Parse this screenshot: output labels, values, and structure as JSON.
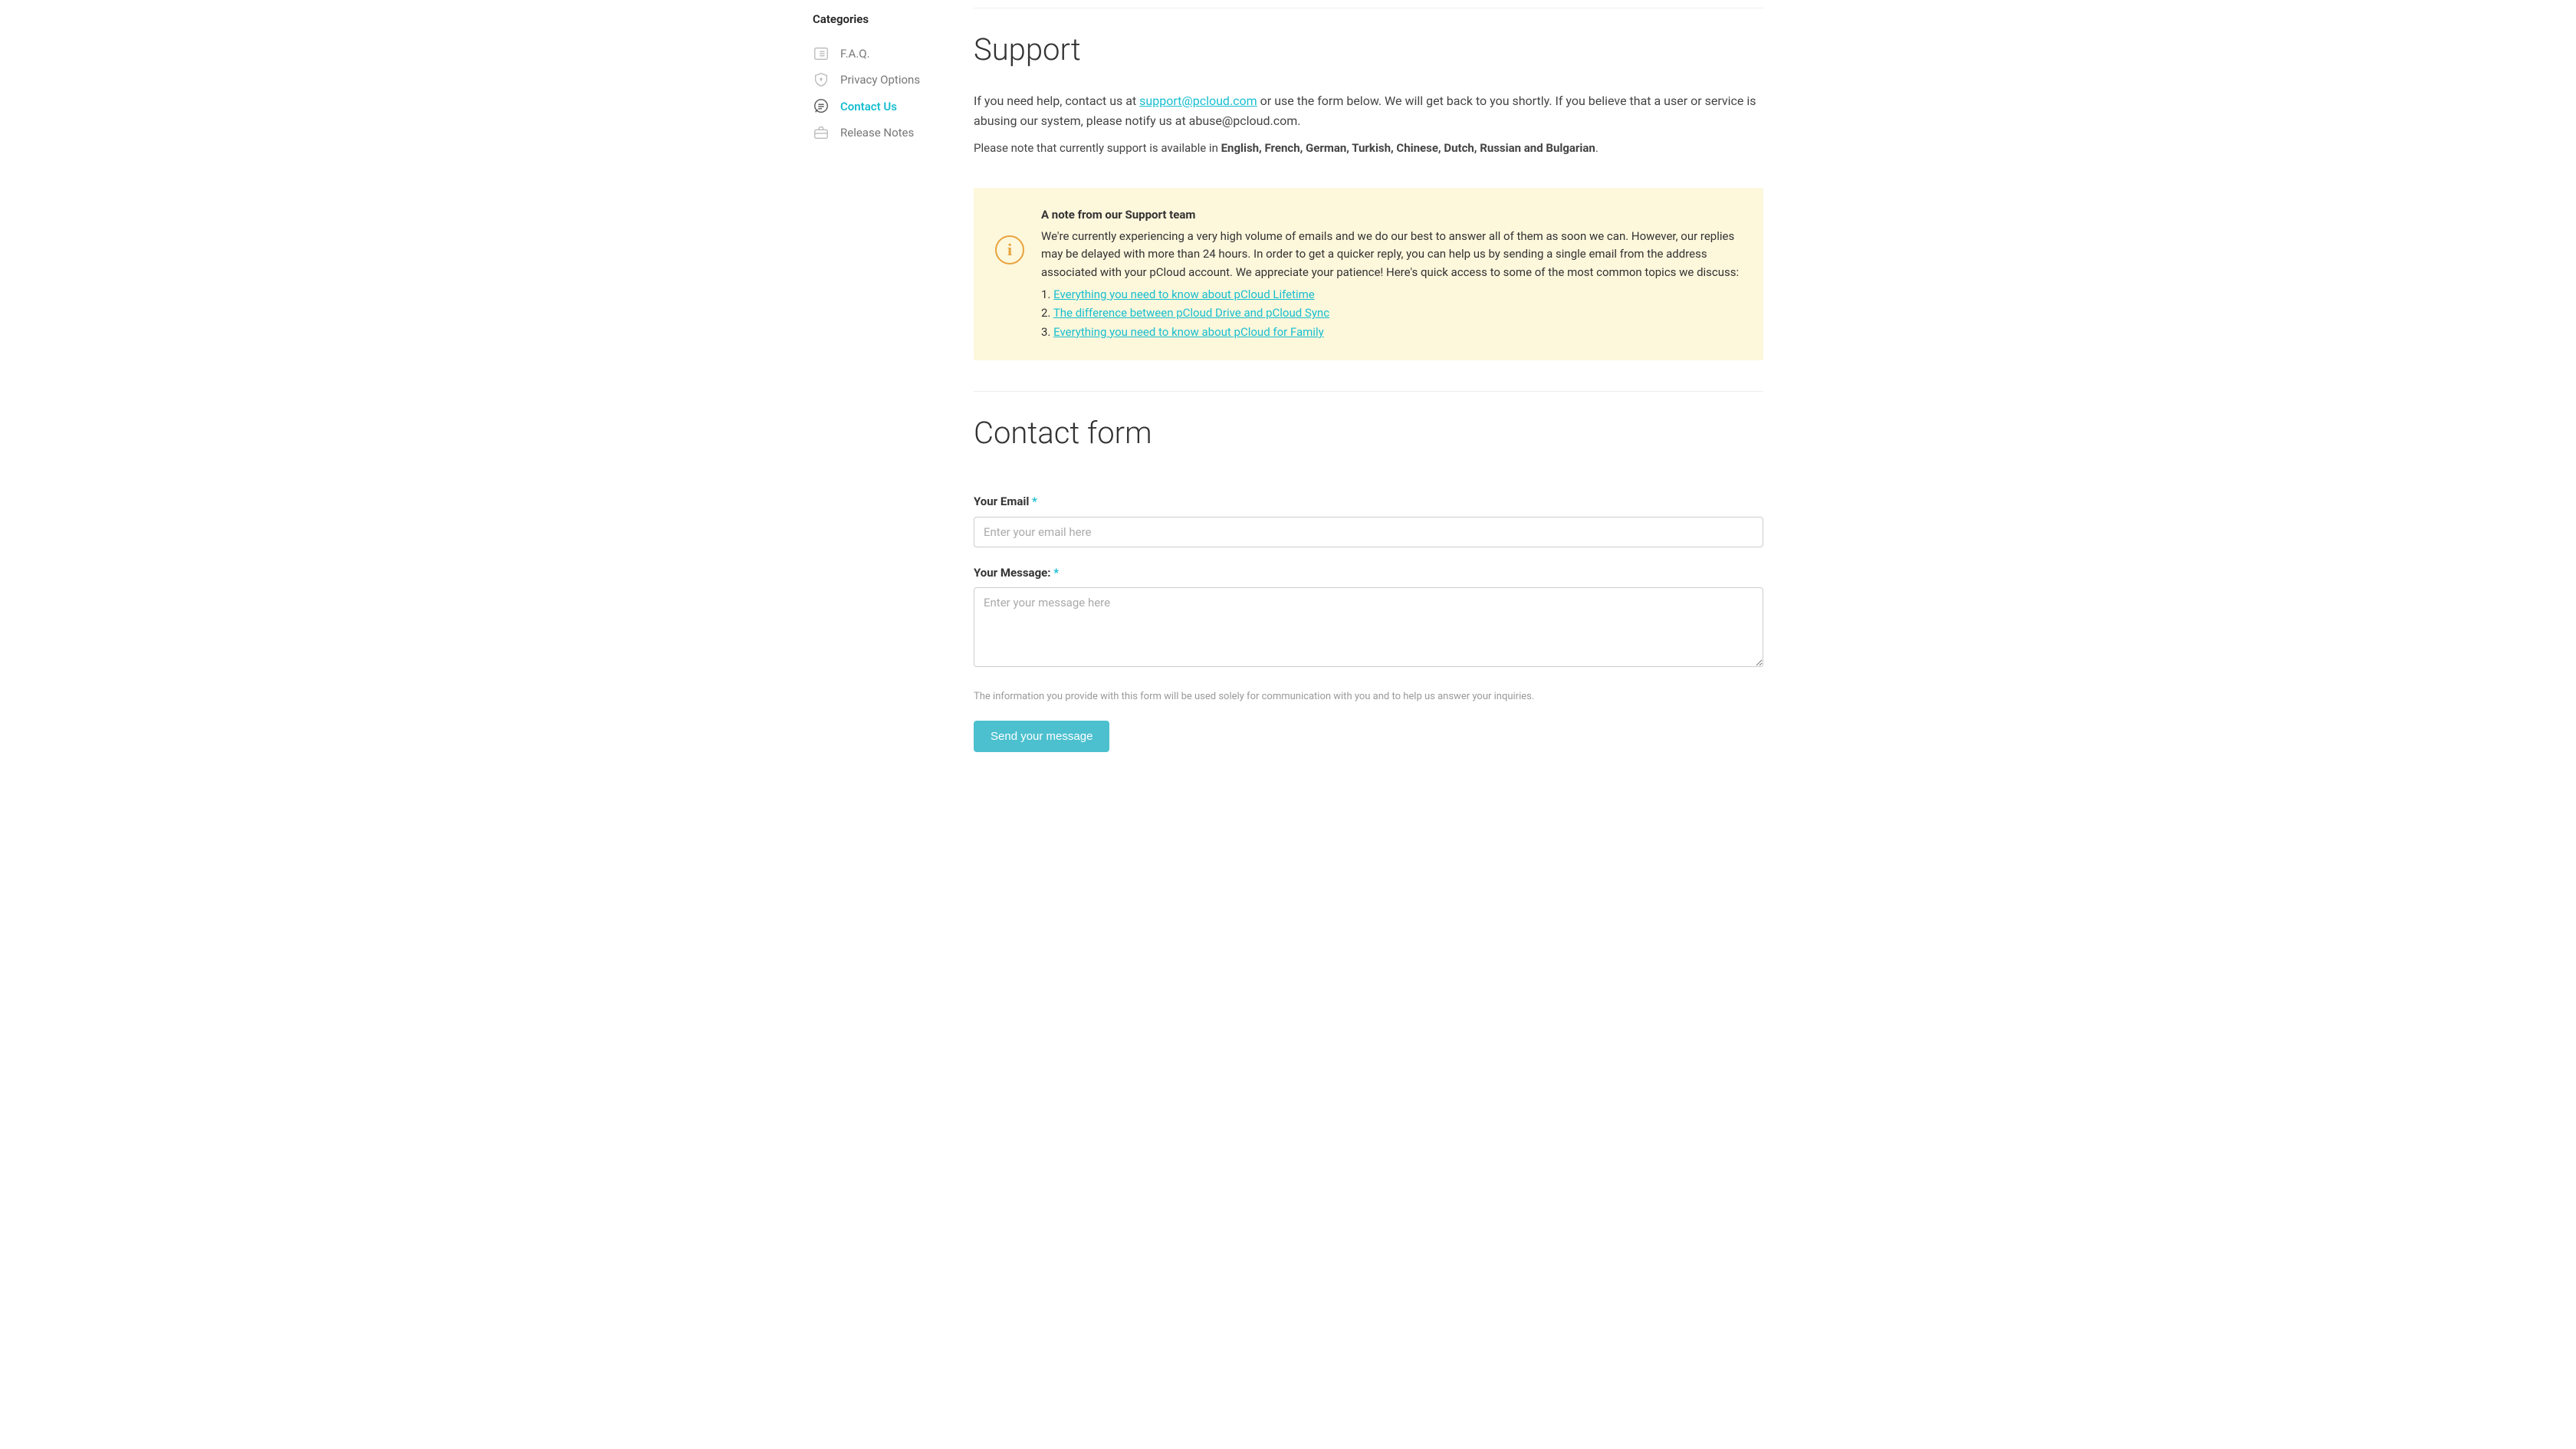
{
  "sidebar": {
    "title": "Categories",
    "items": [
      {
        "label": "F.A.Q."
      },
      {
        "label": "Privacy Options"
      },
      {
        "label": "Contact Us"
      },
      {
        "label": "Release Notes"
      }
    ]
  },
  "support": {
    "heading": "Support",
    "intro_prefix": "If you need help, contact us at ",
    "support_email": "support@pcloud.com",
    "intro_middle": " or use the form below. We will get back to you shortly. If you believe that a user or service is abusing our system, please notify us at ",
    "abuse_email": "abuse@pcloud.com",
    "intro_suffix": ".",
    "langs_prefix": "Please note that currently support is available in ",
    "langs_bold": "English, French, German, Turkish, Chinese, Dutch, Russian and Bulgarian",
    "langs_suffix": "."
  },
  "note": {
    "title": "A note from our Support team",
    "body": "We're currently experiencing a very high volume of emails and we do our best to answer all of them as soon we can. However, our replies may be delayed with more than 24 hours. In order to get a quicker reply, you can help us by sending a single email from the address associated with your pCloud account. We appreciate your patience! Here's quick access to some of the most common topics we discuss:",
    "links": [
      "Everything you need to know about pCloud Lifetime",
      "The difference between pCloud Drive and pCloud Sync",
      "Everything you need to know about pCloud for Family"
    ]
  },
  "contact": {
    "heading": "Contact form",
    "email_label": "Your Email",
    "email_placeholder": "Enter your email here",
    "message_label": "Your Message:",
    "message_placeholder": "Enter your message here",
    "required_mark": "*",
    "disclaimer": "The information you provide with this form will be used solely for communication with you and to help us answer your inquiries.",
    "submit_label": "Send your message"
  }
}
